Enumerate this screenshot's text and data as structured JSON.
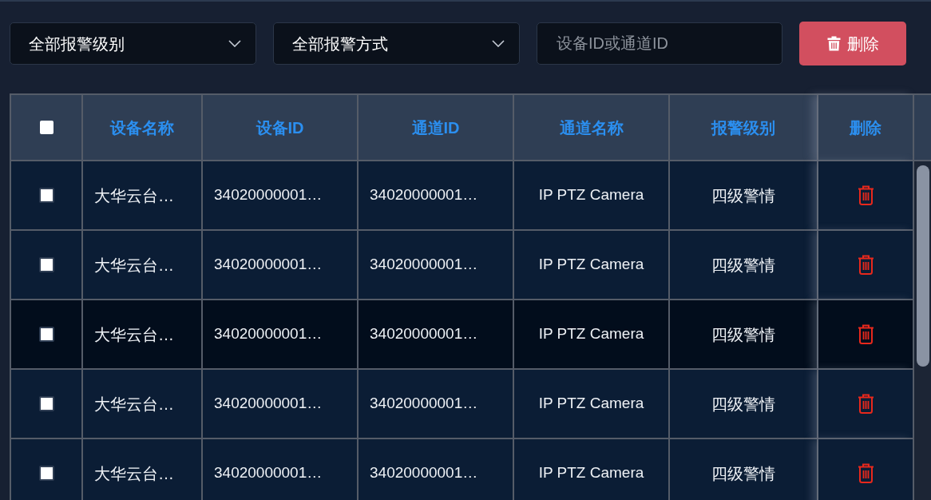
{
  "filters": {
    "level_select": {
      "value": "全部报警级别"
    },
    "method_select": {
      "value": "全部报警方式"
    },
    "search": {
      "placeholder": "设备ID或通道ID"
    },
    "delete_button": {
      "label": "删除"
    }
  },
  "table": {
    "select_all": {
      "checked": false
    },
    "columns": [
      "设备名称",
      "设备ID",
      "通道ID",
      "通道名称",
      "报警级别",
      "删除"
    ],
    "rows": [
      {
        "checked": false,
        "hovered": false,
        "cells": [
          "大华云台…",
          "34020000001…",
          "34020000001…",
          "IP PTZ Camera",
          "四级警情"
        ]
      },
      {
        "checked": false,
        "hovered": false,
        "cells": [
          "大华云台…",
          "34020000001…",
          "34020000001…",
          "IP PTZ Camera",
          "四级警情"
        ]
      },
      {
        "checked": false,
        "hovered": true,
        "cells": [
          "大华云台…",
          "34020000001…",
          "34020000001…",
          "IP PTZ Camera",
          "四级警情"
        ]
      },
      {
        "checked": false,
        "hovered": false,
        "cells": [
          "大华云台…",
          "34020000001…",
          "34020000001…",
          "IP PTZ Camera",
          "四级警情"
        ]
      },
      {
        "checked": false,
        "hovered": false,
        "cells": [
          "大华云台…",
          "34020000001…",
          "34020000001…",
          "IP PTZ Camera",
          "四级警情"
        ]
      }
    ]
  }
}
